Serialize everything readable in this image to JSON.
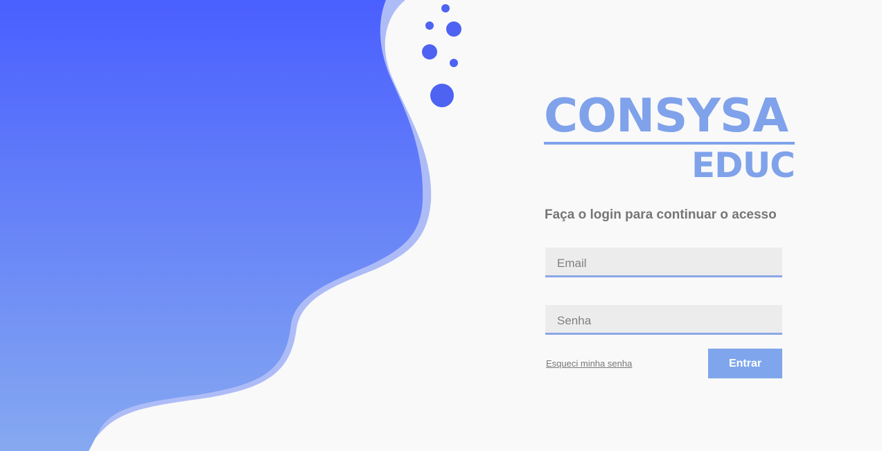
{
  "logo": {
    "name": "CONSYSA",
    "sub": "EDUC"
  },
  "login": {
    "prompt": "Faça o login para continuar o acesso",
    "email_placeholder": "Email",
    "password_placeholder": "Senha",
    "forgot_password": "Esqueci minha senha",
    "submit_label": "Entrar"
  },
  "colors": {
    "accent": "#7fa2ea",
    "wave_top": "#4a5fff",
    "wave_bottom": "#86a9f0",
    "dots": "#4e63f2",
    "background": "#f9f9f9"
  }
}
